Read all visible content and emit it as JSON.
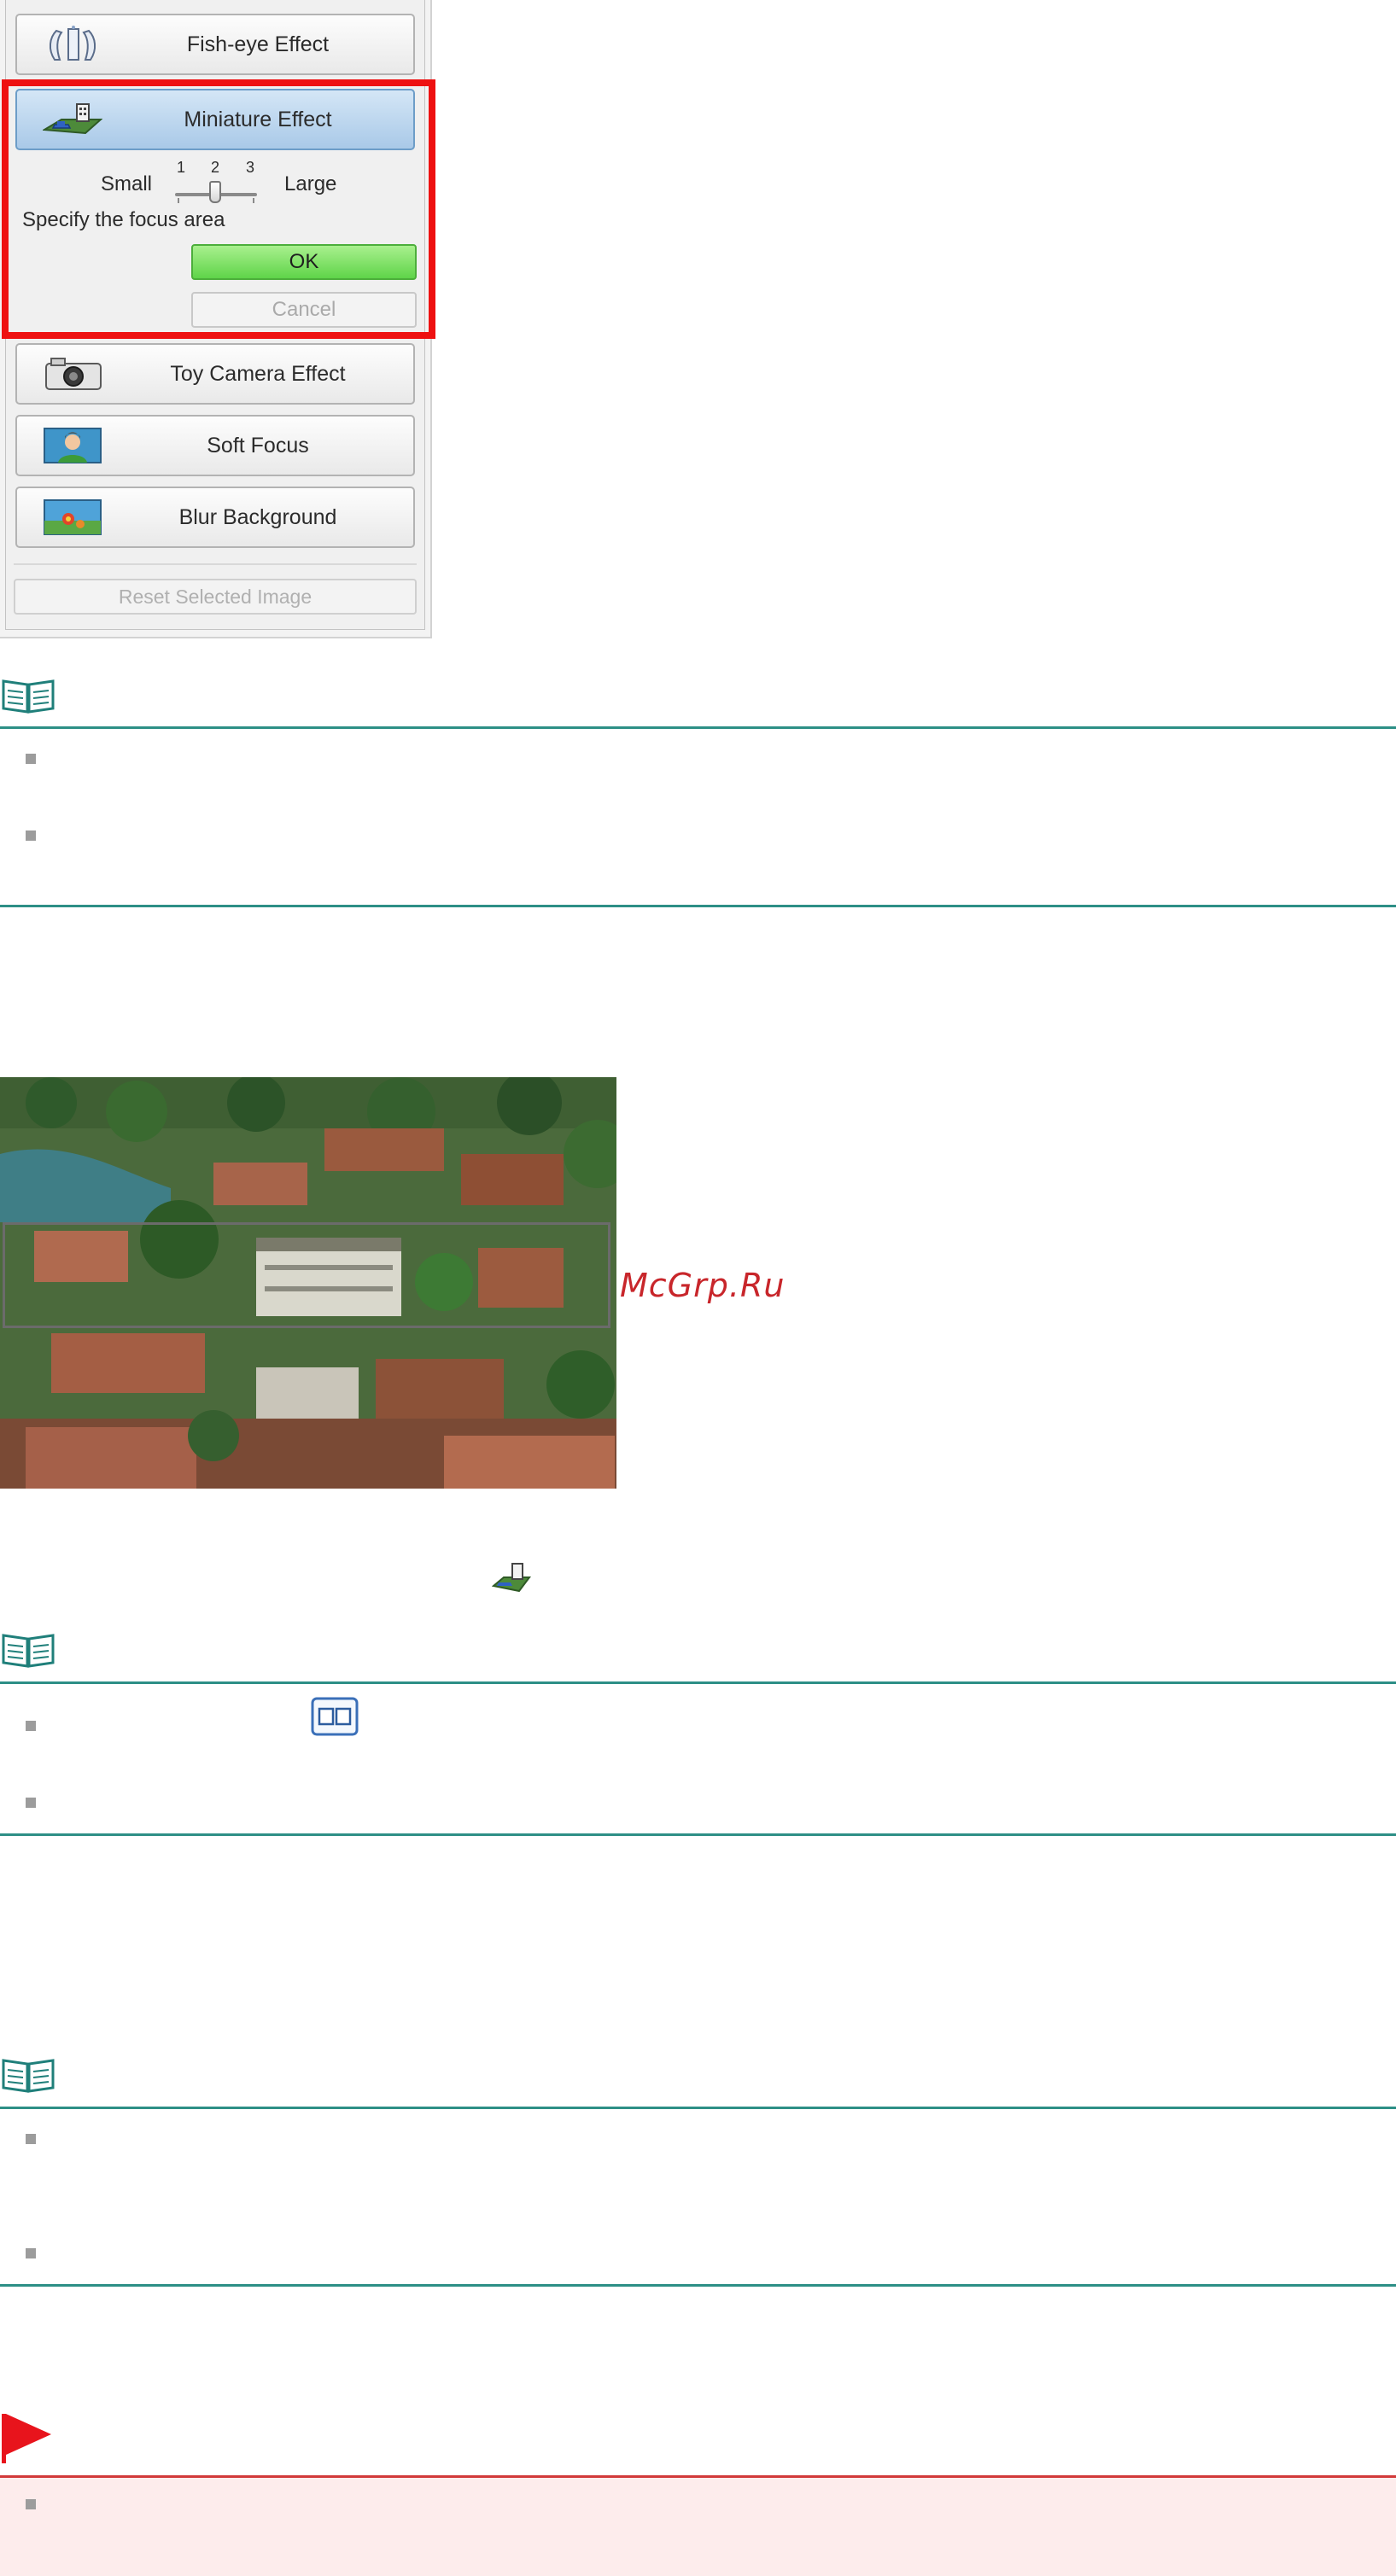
{
  "effects_panel": {
    "fisheye_label": "Fish-eye Effect",
    "miniature_label": "Miniature Effect",
    "size_small_label": "Small",
    "size_large_label": "Large",
    "scale_ticks": [
      "1",
      "2",
      "3"
    ],
    "slider_value": 2,
    "focus_instruction": "Specify the focus area",
    "ok_label": "OK",
    "cancel_label": "Cancel",
    "toy_camera_label": "Toy Camera Effect",
    "soft_focus_label": "Soft Focus",
    "blur_background_label": "Blur Background",
    "reset_label": "Reset Selected Image"
  },
  "watermark": "McGrp.Ru",
  "colors": {
    "note_rule": "#2d8f86",
    "highlight_frame": "#ee1111",
    "ok_button": "#5fd449",
    "caution_flag": "#e8141c",
    "caution_bg": "#fdecec"
  },
  "icons": {
    "note": "open-book-icon",
    "caution": "red-flag-icon",
    "miniature": "miniature-diorama-icon",
    "compare": "compare-view-icon"
  }
}
